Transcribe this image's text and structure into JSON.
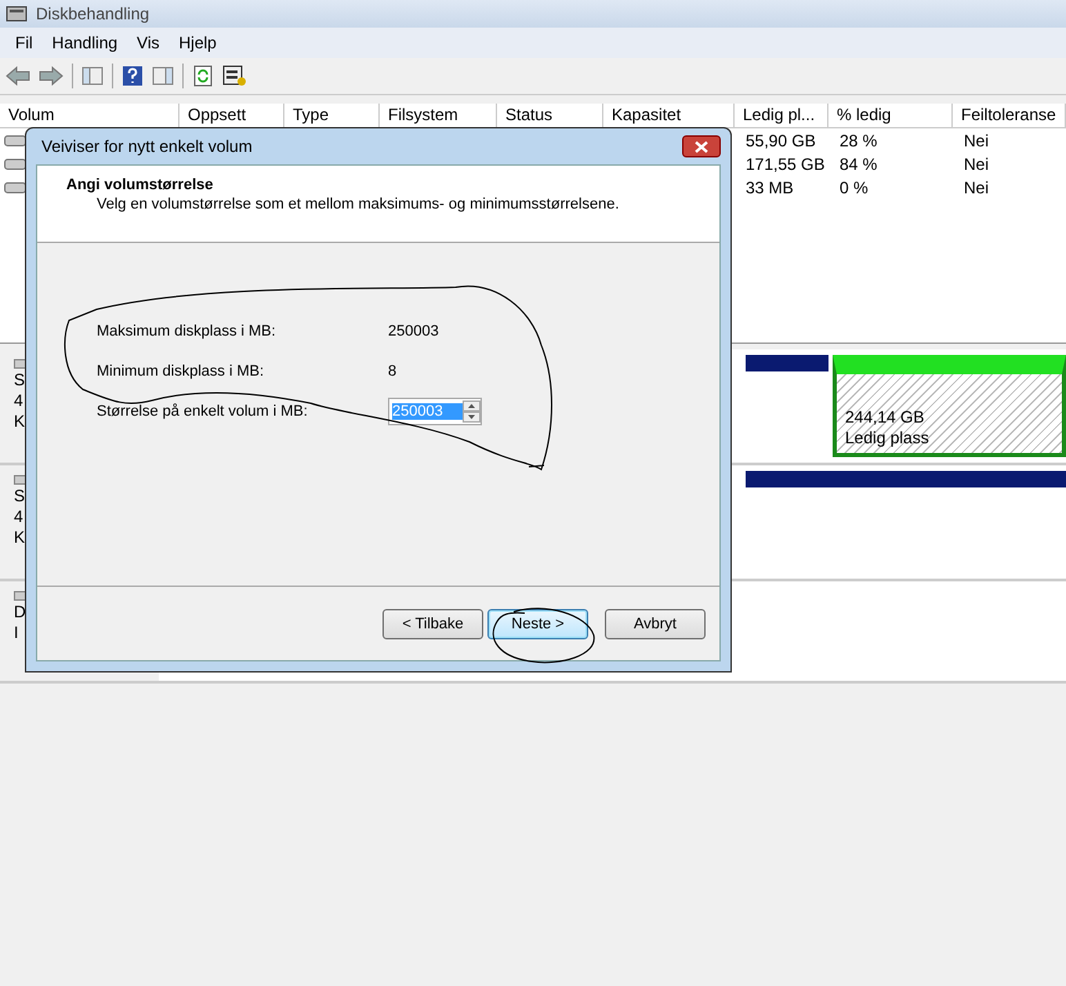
{
  "window": {
    "title": "Diskbehandling"
  },
  "menu": [
    "Fil",
    "Handling",
    "Vis",
    "Hjelp"
  ],
  "table": {
    "columns": [
      "Volum",
      "Oppsett",
      "Type",
      "Filsystem",
      "Status",
      "Kapasitet",
      "Ledig pl...",
      "% ledig",
      "Feiltoleranse"
    ],
    "rows": [
      {
        "free": "55,90 GB",
        "percent_free": "28 %",
        "fault_tolerance": "Nei"
      },
      {
        "free": "171,55 GB",
        "percent_free": "84 %",
        "fault_tolerance": "Nei"
      },
      {
        "free": "33 MB",
        "percent_free": "0 %",
        "fault_tolerance": "Nei"
      }
    ]
  },
  "disks": [
    {
      "lines": [
        "S",
        "4",
        "K"
      ],
      "partition": {
        "size": "244,14 GB",
        "label": "Ledig plass"
      }
    },
    {
      "lines": [
        "S",
        "4",
        "K"
      ]
    },
    {
      "lines": [
        "D",
        "I"
      ]
    }
  ],
  "dialog": {
    "title": "Veiviser for nytt enkelt volum",
    "heading": "Angi volumstørrelse",
    "subtitle": "Velg en volumstørrelse som et mellom maksimums- og minimumsstørrelsene.",
    "info": [
      {
        "label": "Maksimum diskplass i MB:",
        "value": "250003"
      },
      {
        "label": "Minimum diskplass i MB:",
        "value": "8"
      }
    ],
    "size_field": {
      "label": "Størrelse på enkelt volum i MB:",
      "value": "250003",
      "selected": true
    },
    "buttons": [
      {
        "label": "< Tilbake",
        "default": false
      },
      {
        "label": "Neste >",
        "default": true
      },
      {
        "label": "Avbryt",
        "default": false
      }
    ]
  }
}
